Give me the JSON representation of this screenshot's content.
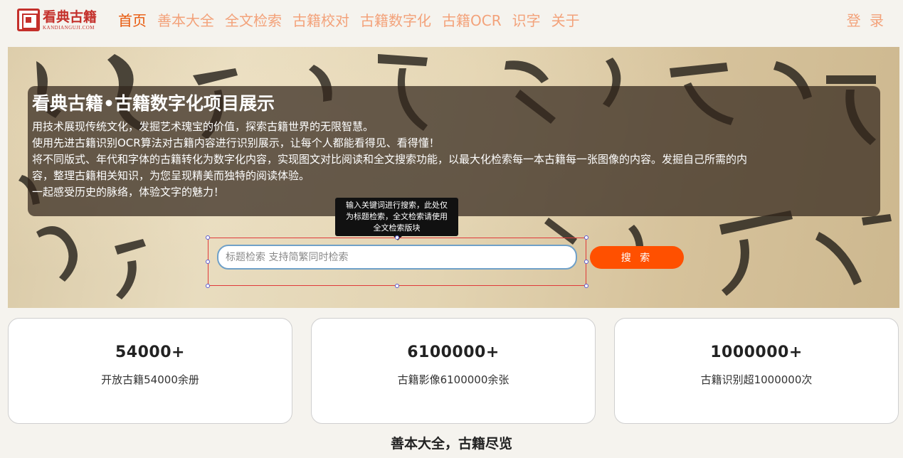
{
  "header": {
    "logo_cn": "看典古籍",
    "logo_en": "KANDIANGUJI.COM",
    "nav": [
      "首页",
      "善本大全",
      "全文检索",
      "古籍校对",
      "古籍数字化",
      "古籍OCR",
      "识字",
      "关于"
    ],
    "login": "登 录"
  },
  "hero": {
    "title": "看典古籍•古籍数字化项目展示",
    "lines": [
      "用技术展现传统文化，发掘艺术瑰宝的价值，探索古籍世界的无限智慧。",
      "使用先进古籍识别OCR算法对古籍内容进行识别展示，让每个人都能看得见、看得懂！",
      "将不同版式、年代和字体的古籍转化为数字化内容，实现图文对比阅读和全文搜索功能，以最大化检索每一本古籍每一张图像的内容。发掘自己所需的内",
      "容，整理古籍相关知识，为您呈现精美而独特的阅读体验。",
      "一起感受历史的脉络，体验文字的魅力！"
    ],
    "tooltip": [
      "输入关键词进行搜索，此处仅",
      "为标题检索，全文检索请使用",
      "全文检索版块"
    ],
    "search_placeholder": "标题检索 支持简繁同时检索",
    "search_button": "搜 索"
  },
  "stats": [
    {
      "number": "54000+",
      "desc": "开放古籍54000余册"
    },
    {
      "number": "6100000+",
      "desc": "古籍影像6100000余张"
    },
    {
      "number": "1000000+",
      "desc": "古籍识别超1000000次"
    }
  ],
  "section_title": "善本大全，古籍尽览",
  "colors": {
    "accent": "#e8590c",
    "nav": "#f3a27a",
    "button": "#ff5000",
    "logo": "#c4302b"
  }
}
